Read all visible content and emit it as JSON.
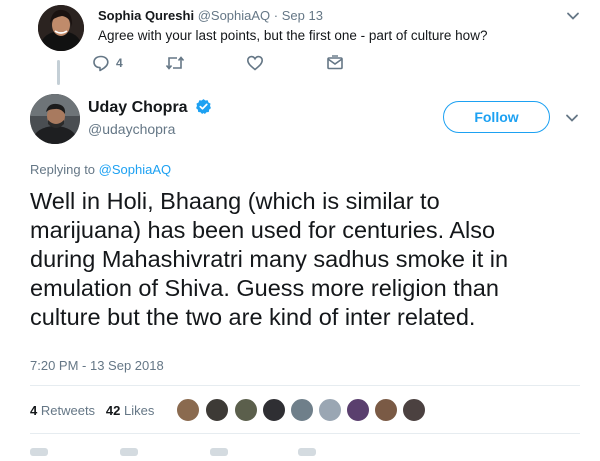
{
  "parent_tweet": {
    "author_name": "Sophia Qureshi",
    "author_handle": "@SophiaAQ",
    "separator": "·",
    "date": "Sep 13",
    "text": "Agree with your last points, but the first one - part of culture how?",
    "reply_count": "4"
  },
  "main_tweet": {
    "author_name": "Uday Chopra",
    "author_handle": "@udaychopra",
    "follow_label": "Follow",
    "replying_prefix": "Replying to",
    "replying_handle": "@SophiaAQ",
    "text_lines": [
      "Well in Holi, Bhaang (which is similar to",
      "marijuana) has been used for centuries. Also",
      "during Mahashivratri many sadhus smoke it in",
      "emulation of Shiva. Guess more religion than",
      "culture but the two are kind of inter related."
    ],
    "timestamp": "7:20 PM - 13 Sep 2018",
    "retweet_count": "4",
    "retweet_label": "Retweets",
    "like_count": "42",
    "like_label": "Likes"
  },
  "colors": {
    "accent": "#1da1f2",
    "verified": "#1da1f2",
    "muted_text": "#657786",
    "border": "#e6ecf0"
  },
  "icons": {
    "parent_actions": [
      "reply-icon",
      "retweet-icon",
      "like-icon",
      "direct-message-icon"
    ],
    "menu": "chevron-down-icon",
    "verified": "verified-badge-icon"
  }
}
